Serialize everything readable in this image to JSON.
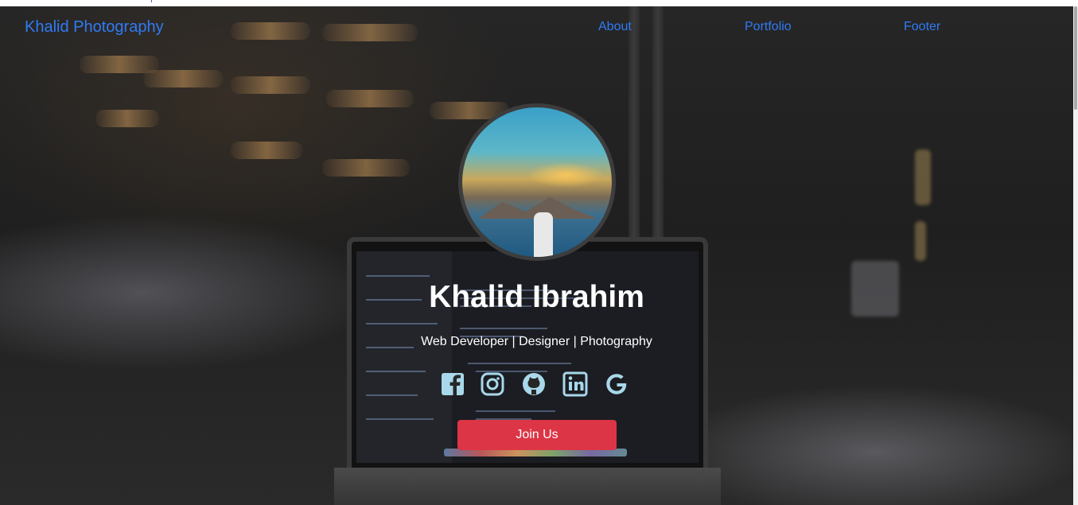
{
  "navbar": {
    "brand": "Khalid Photography",
    "links": [
      "About",
      "Portfolio",
      "Footer"
    ],
    "link_color": "#2f7bf5"
  },
  "hero": {
    "title": "Khalid Ibrahim",
    "subtitle": "Web Developer | Designer | Photography",
    "social_icons": [
      "facebook-icon",
      "instagram-icon",
      "github-icon",
      "linkedin-icon",
      "google-icon"
    ],
    "icon_color": "#a8d8ea",
    "cta_label": "Join Us",
    "cta_color": "#dc3545"
  }
}
